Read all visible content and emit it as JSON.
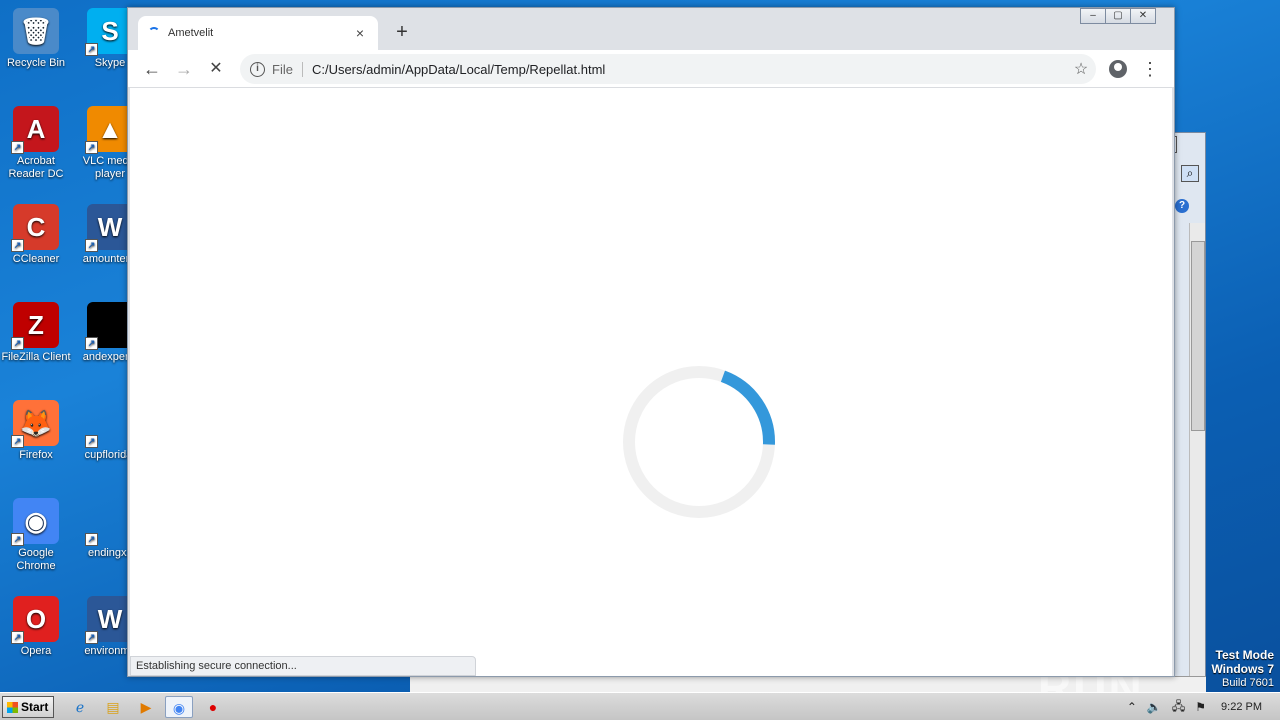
{
  "desktop": {
    "icons": [
      {
        "label": "Recycle Bin",
        "color": "#4a8ac9",
        "glyph": "🗑"
      },
      {
        "label": "Skype",
        "color": "#00aff0",
        "glyph": "S"
      },
      {
        "label": "Acrobat Reader DC",
        "color": "#c4161c",
        "glyph": "A"
      },
      {
        "label": "VLC media player",
        "color": "#f08a00",
        "glyph": "▲"
      },
      {
        "label": "CCleaner",
        "color": "#d63a2a",
        "glyph": "C"
      },
      {
        "label": "amountenc",
        "color": "#2b5797",
        "glyph": "W"
      },
      {
        "label": "FileZilla Client",
        "color": "#bf0000",
        "glyph": "Z"
      },
      {
        "label": "andexperie",
        "color": "#000000",
        "glyph": ""
      },
      {
        "label": "Firefox",
        "color": "#ff7139",
        "glyph": "🦊"
      },
      {
        "label": "cupflorida.",
        "color": "transparent",
        "glyph": ""
      },
      {
        "label": "Google Chrome",
        "color": "#4285f4",
        "glyph": "◉"
      },
      {
        "label": "endingxx",
        "color": "transparent",
        "glyph": ""
      },
      {
        "label": "Opera",
        "color": "#e0201f",
        "glyph": "O"
      },
      {
        "label": "environme",
        "color": "#2b5797",
        "glyph": "W"
      }
    ],
    "watermark": "ANY RUN",
    "test_mode": {
      "line1": "Test Mode",
      "line2": "Windows 7",
      "line3": "Build 7601"
    }
  },
  "browser": {
    "tab_title": "Ametvelit",
    "tab_close": "×",
    "new_tab": "+",
    "window_controls": {
      "minimize": "‒",
      "maximize": "▢",
      "close": "✕"
    },
    "back": "←",
    "forward": "→",
    "stop": "✕",
    "scheme": "File",
    "url": "C:/Users/admin/AppData/Local/Temp/Repellat.html",
    "bookmark_star": "☆",
    "menu": "⋮",
    "status_text": "Establishing secure connection...",
    "spinner": {
      "track_color": "#f0f0f0",
      "arc_color": "#3498db",
      "progress": 0.2
    }
  },
  "taskbar": {
    "start_label": "Start",
    "clock": "9:22 PM",
    "tray_icons": [
      "⌃",
      "🔈",
      "🖧",
      "⚑"
    ]
  }
}
